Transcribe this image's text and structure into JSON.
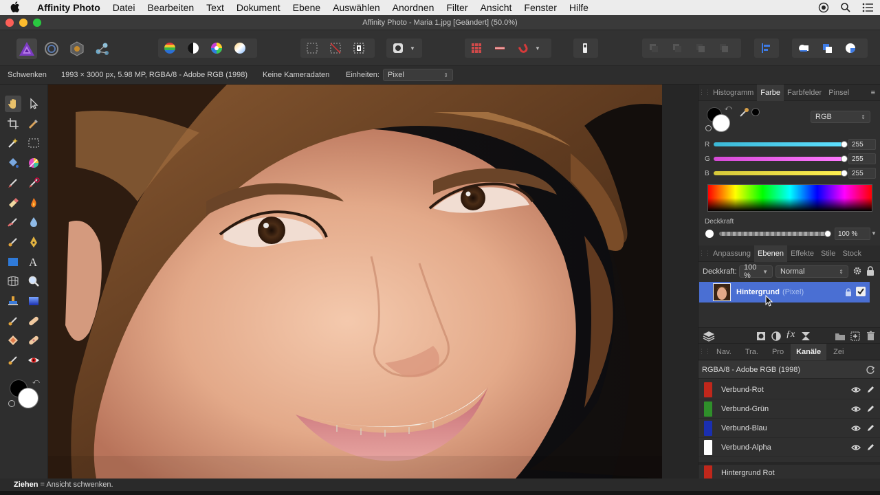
{
  "menubar": {
    "app_name": "Affinity Photo",
    "items": [
      "Datei",
      "Bearbeiten",
      "Text",
      "Dokument",
      "Ebene",
      "Auswählen",
      "Anordnen",
      "Filter",
      "Ansicht",
      "Fenster",
      "Hilfe"
    ]
  },
  "window": {
    "title": "Affinity Photo - Maria 1.jpg [Geändert] (50.0%)"
  },
  "context": {
    "tool_name": "Schwenken",
    "doc_info": "1993 × 3000 px, 5.98 MP, RGBA/8 - Adobe RGB (1998)",
    "camera": "Keine Kameradaten",
    "units_label": "Einheiten:",
    "units_value": "Pixel"
  },
  "color_panel": {
    "tabs": [
      "Histogramm",
      "Farbe",
      "Farbfelder",
      "Pinsel"
    ],
    "active_tab": "Farbe",
    "mode": "RGB",
    "r_label": "R",
    "g_label": "G",
    "b_label": "B",
    "r_value": "255",
    "g_value": "255",
    "b_value": "255",
    "r_level": 1.0,
    "g_level": 1.0,
    "b_level": 1.0,
    "opacity_label": "Deckkraft",
    "opacity_value": "100 %",
    "opacity_level": 1.0
  },
  "layers_panel": {
    "tabs": [
      "Anpassung",
      "Ebenen",
      "Effekte",
      "Stile",
      "Stock"
    ],
    "active_tab": "Ebenen",
    "opacity_label": "Deckkraft:",
    "opacity_value": "100 %",
    "blend_mode": "Normal",
    "layer_name": "Hintergrund",
    "layer_type": "(Pixel)"
  },
  "channels_panel": {
    "tabs": [
      "Nav.",
      "Tra.",
      "Pro",
      "Kanäle",
      "Zei"
    ],
    "active_tab": "Kanäle",
    "header": "RGBA/8 - Adobe RGB (1998)",
    "channels": [
      {
        "name": "Verbund-Rot",
        "color": "#c0271b"
      },
      {
        "name": "Verbund-Grün",
        "color": "#2f8f2a"
      },
      {
        "name": "Verbund-Blau",
        "color": "#1a2fb0"
      },
      {
        "name": "Verbund-Alpha",
        "color": "#ffffff"
      },
      {
        "name": "Hintergrund Rot",
        "color": "#c0271b"
      }
    ]
  },
  "status": {
    "key": "Ziehen",
    "text": " = Ansicht schwenken."
  },
  "colors": {
    "accent": "#4a6fd3",
    "panel": "#2f2f2f"
  }
}
